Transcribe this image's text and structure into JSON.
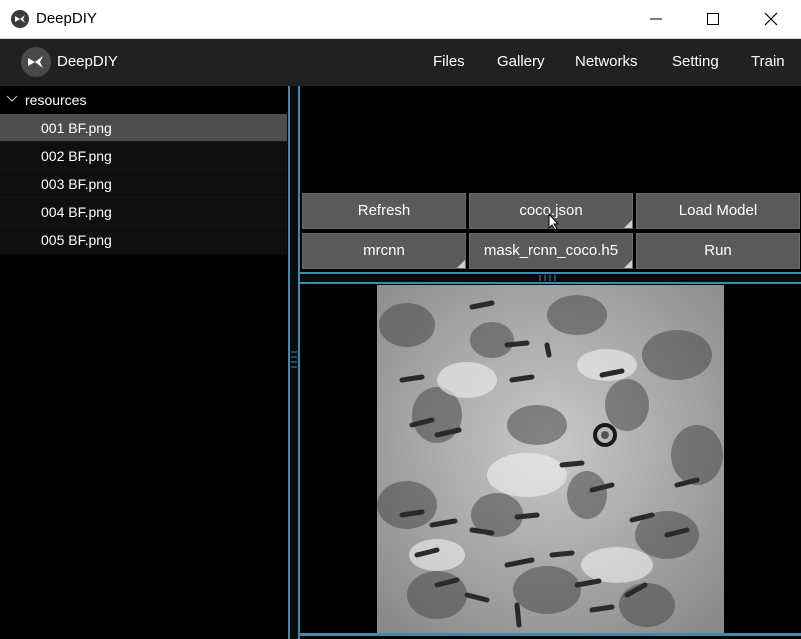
{
  "window": {
    "title": "DeepDIY"
  },
  "menubar": {
    "brand": "DeepDIY",
    "items": [
      {
        "label": "Files"
      },
      {
        "label": "Gallery"
      },
      {
        "label": "Networks"
      },
      {
        "label": "Setting"
      },
      {
        "label": "Train"
      }
    ]
  },
  "tree": {
    "root": "resources",
    "files": [
      "001 BF.png",
      "002 BF.png",
      "003 BF.png",
      "004 BF.png",
      "005 BF.png"
    ],
    "selected_index": 0
  },
  "buttons": {
    "refresh": "Refresh",
    "config": "coco.json",
    "load_model": "Load Model",
    "network": "mrcnn",
    "weights": "mask_rcnn_coco.h5",
    "run": "Run"
  },
  "colors": {
    "accent": "#3e8bb0",
    "button": "#5a5a5a",
    "menubar": "#212121",
    "selected_row": "#4d4d4d"
  },
  "icons": {
    "app": "kivy-logo-icon",
    "minimize": "minimize-icon",
    "maximize": "maximize-icon",
    "close": "close-icon",
    "tree_toggle": "chevron-down-icon"
  }
}
